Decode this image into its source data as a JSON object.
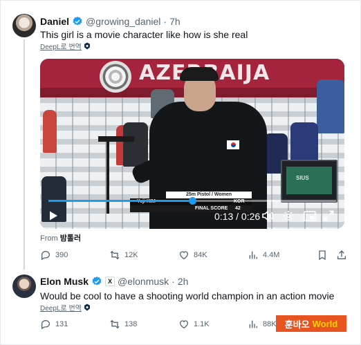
{
  "tweet1": {
    "name": "Daniel",
    "handle": "@growing_daniel",
    "separator": "·",
    "time": "7h",
    "text": "This girl is a movie character like how is she real",
    "translate_label": "DeepL로 번역",
    "video": {
      "banner_text": "AZERBAIJA",
      "score_event": "25m Pistol / Women",
      "athlete_name": "Yeji KIM",
      "athlete_country": "KOR",
      "final_score_label": "FINAL SCORE",
      "final_score_value": "42",
      "elapsed": "0:13",
      "duration": "0:26",
      "time_separator": " / ",
      "progress": 0.5,
      "monitor_logo": "SIUS"
    },
    "from_label": "From",
    "from_source": "밤톨러",
    "stats": {
      "replies": "390",
      "reposts": "12K",
      "likes": "84K",
      "views": "4.4M"
    }
  },
  "tweet2": {
    "name": "Elon Musk",
    "affiliation_badge": "X",
    "handle": "@elonmusk",
    "separator": "·",
    "time": "2h",
    "text": "Would be cool to have a shooting world champion in an action movie",
    "translate_label": "DeepL로 번역",
    "stats": {
      "replies": "131",
      "reposts": "138",
      "likes": "1.1K",
      "views": "88K"
    }
  },
  "watermark": {
    "part1": "훈바오",
    "part2": "World"
  },
  "colors": {
    "verified": "#1d9bf0",
    "text": "#0f1419",
    "muted": "#536471",
    "progress": "#1d9bf0",
    "watermark_bg": "#e8541f"
  }
}
